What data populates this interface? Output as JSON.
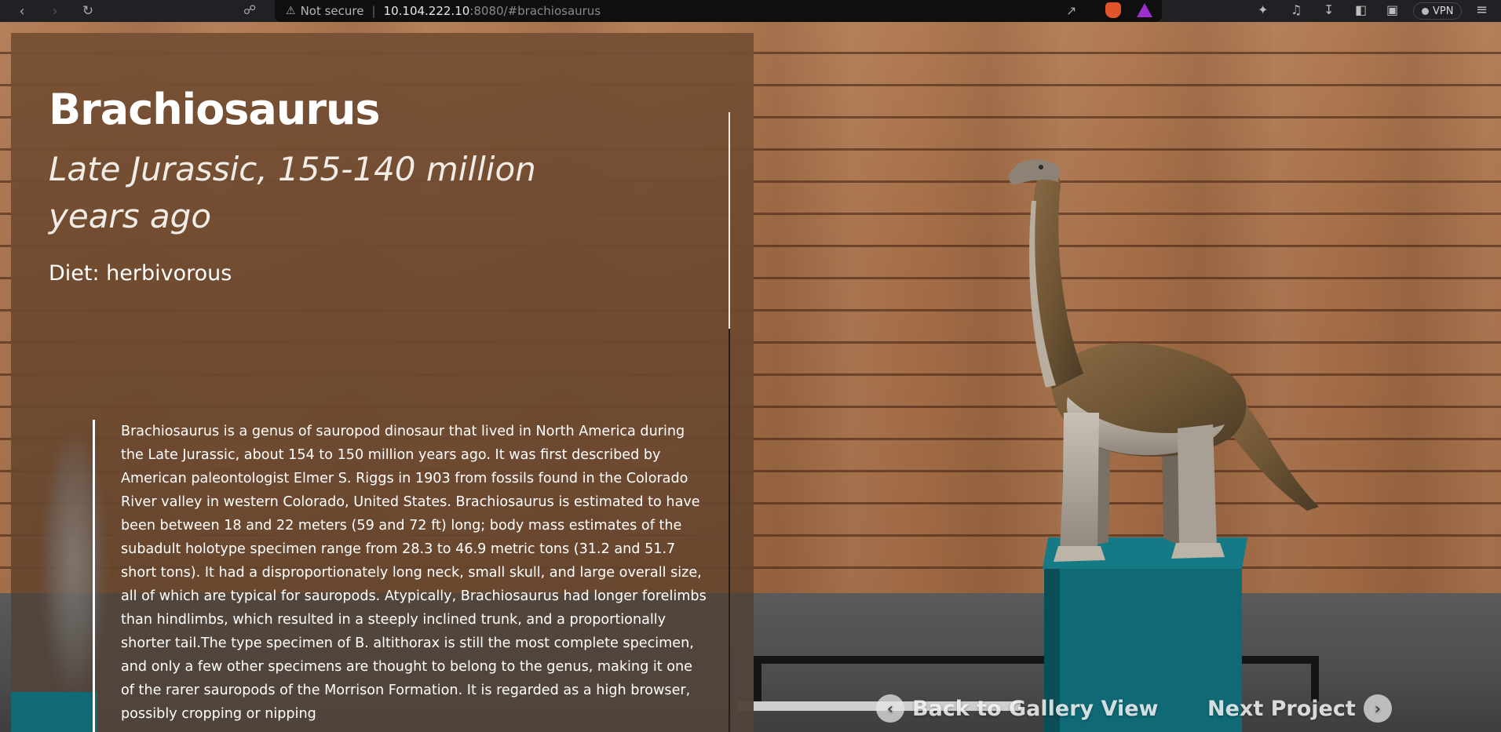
{
  "browser": {
    "security_label": "Not secure",
    "url_host": "10.104.222.10",
    "url_rest": ":8080/#brachiosaurus",
    "vpn_label": "VPN"
  },
  "exhibit": {
    "title": "Brachiosaurus",
    "period": "Late Jurassic, 155-140 million years ago",
    "diet": "Diet: herbivorous",
    "description": "Brachiosaurus is a genus of sauropod dinosaur that lived in North America during the Late Jurassic, about 154 to 150 million years ago. It was first described by American paleontologist Elmer S. Riggs in 1903 from fossils found in the Colorado River valley in western Colorado, United States. Brachiosaurus is estimated to have been between 18 and 22 meters (59 and 72 ft) long; body mass estimates of the subadult holotype specimen range from 28.3 to 46.9 metric tons (31.2 and 51.7 short tons). It had a disproportionately long neck, small skull, and large overall size, all of which are typical for sauropods. Atypically, Brachiosaurus had longer forelimbs than hindlimbs, which resulted in a steeply inclined trunk, and a proportionally shorter tail.The type specimen of B. altithorax is still the most complete specimen, and only a few other specimens are thought to belong to the genus, making it one of the rarer sauropods of the Morrison Formation. It is regarded as a high browser, possibly cropping or nipping"
  },
  "navigation": {
    "back_label": "Back to Gallery View",
    "next_label": "Next Project"
  },
  "colors": {
    "pedestal": "#0f6a75",
    "panel": "#6c482e",
    "wall": "#a56e47"
  }
}
